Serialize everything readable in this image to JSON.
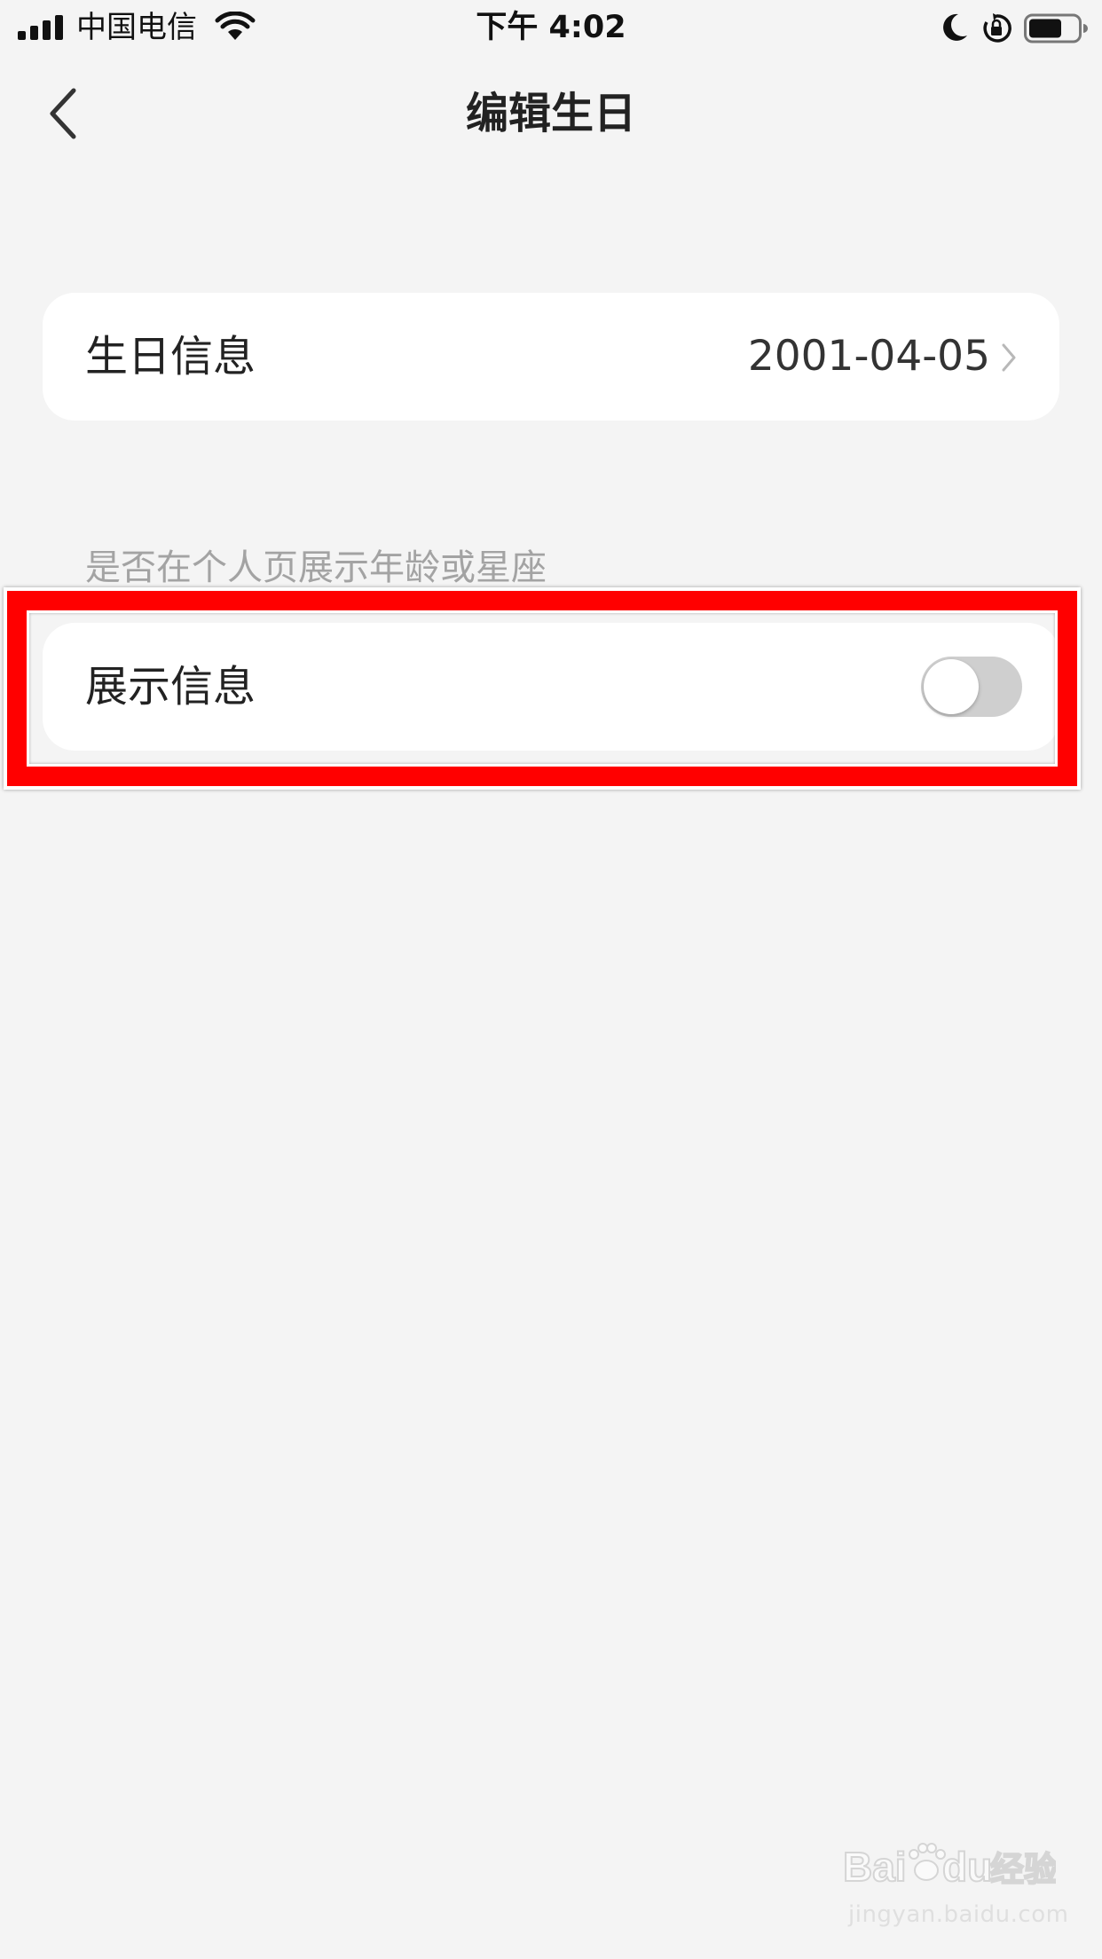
{
  "status_bar": {
    "carrier": "中国电信",
    "time": "下午 4:02",
    "icons": [
      "signal-icon",
      "wifi-icon",
      "moon-icon",
      "rotation-lock-icon",
      "battery-icon"
    ]
  },
  "nav": {
    "title": "编辑生日",
    "back_icon": "chevron-left-icon"
  },
  "birthday_row": {
    "label": "生日信息",
    "value": "2001-04-05",
    "icon": "chevron-right-icon"
  },
  "section_hint": "是否在个人页展示年龄或星座",
  "show_info_row": {
    "label": "展示信息",
    "toggle_on": false
  },
  "watermark": {
    "logo_text": "Baidu经验",
    "url": "jingyan.baidu.com"
  },
  "colors": {
    "background": "#f4f4f4",
    "card": "#ffffff",
    "hint_text": "#a3a3a3",
    "highlight": "#ff0000",
    "toggle_off": "#cfcfcf"
  }
}
